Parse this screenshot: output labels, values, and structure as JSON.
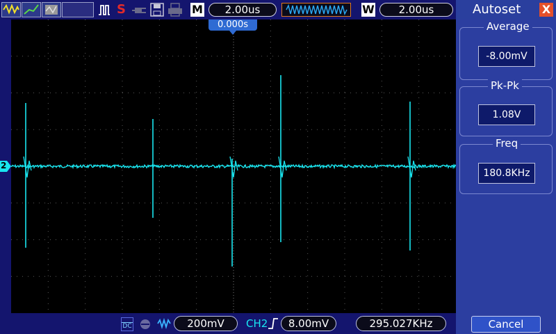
{
  "toolbar": {
    "run_state": "S",
    "memory_letter": "M",
    "timebase": "2.00us",
    "window_letter": "W",
    "window_timebase": "2.00us"
  },
  "trigger": {
    "position": "0.000s"
  },
  "channel": {
    "marker": "2",
    "color": "#19e6f0"
  },
  "status": {
    "coupling": "DC",
    "volts_per_div": "200mV",
    "trigger_source": "CH2",
    "trigger_level": "8.00mV",
    "frequency": "295.027KHz"
  },
  "panel": {
    "title": "Autoset",
    "close_label": "X",
    "measurements": [
      {
        "label": "Average",
        "value": "-8.00mV"
      },
      {
        "label": "Pk-Pk",
        "value": "1.08V"
      },
      {
        "label": "Freq",
        "value": "180.8KHz"
      }
    ],
    "cancel_label": "Cancel"
  },
  "icons": [
    "waveform-yellow-icon",
    "waveform-green-icon",
    "waveform-gray-icon",
    "pulse-icon",
    "plug-icon",
    "save-icon",
    "print-icon",
    "bandwidth-limit-icon",
    "ac-icon",
    "trigger-edge-icon"
  ]
}
